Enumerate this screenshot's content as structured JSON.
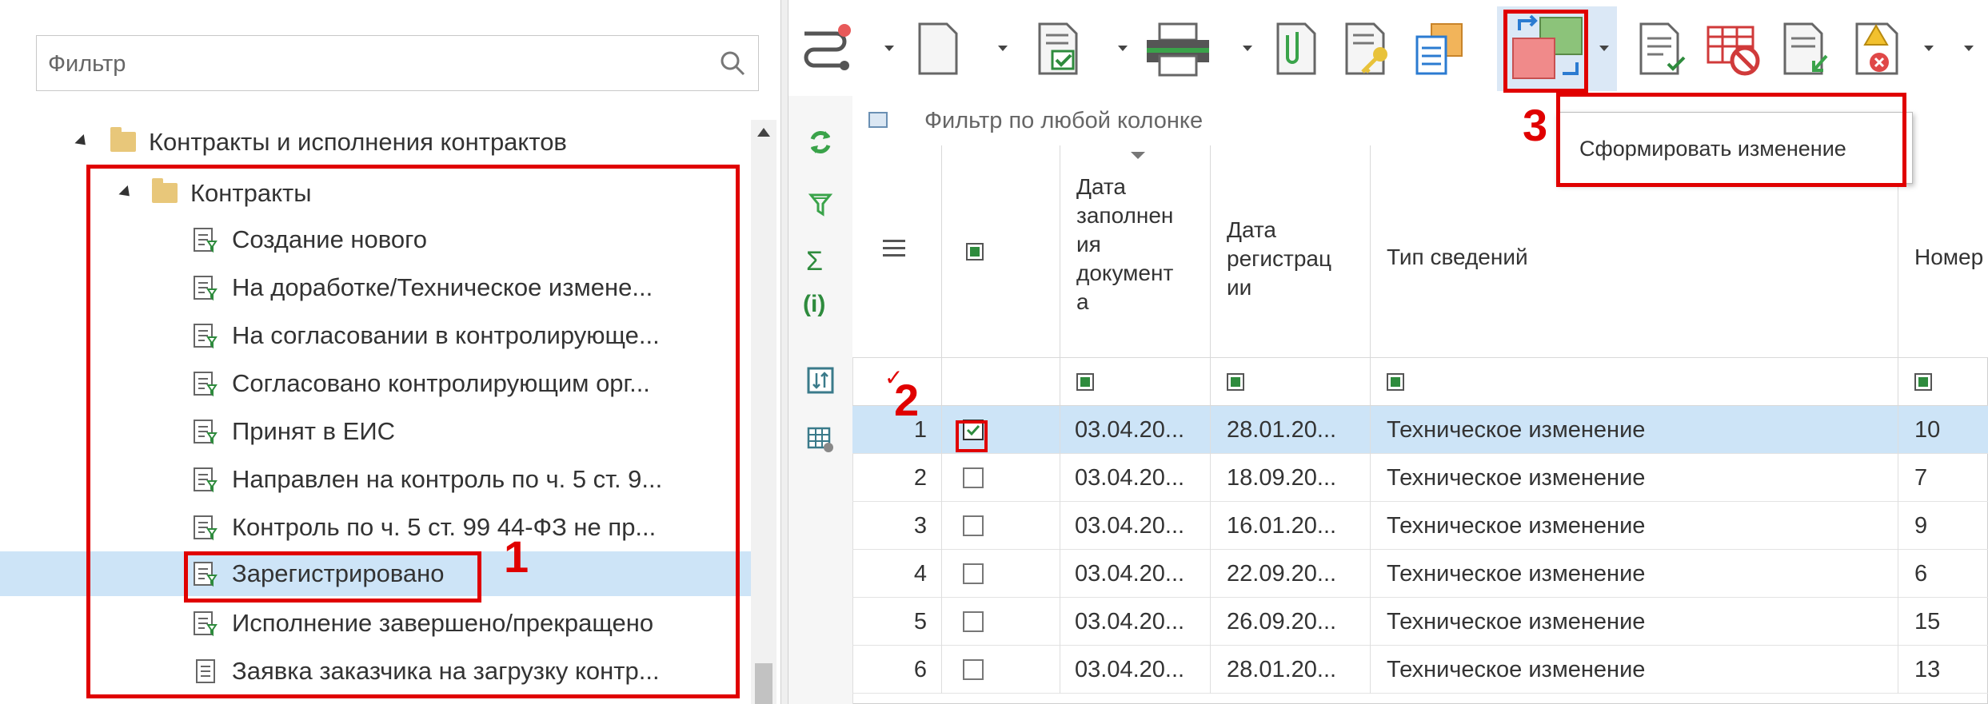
{
  "left_panel": {
    "filter_placeholder": "Фильтр",
    "tree": {
      "root": "Контракты и исполнения контрактов",
      "folder": "Контракты",
      "items": [
        "Создание нового",
        "На доработке/Техническое измене...",
        "На согласовании в контролирующе...",
        "Согласовано контролирующим орг...",
        "Принят в ЕИС",
        "Направлен на контроль по ч. 5 ст. 9...",
        "Контроль по ч. 5 ст. 99 44-ФЗ не пр...",
        "Зарегистрировано",
        "Исполнение завершено/прекращено",
        "Заявка заказчика на загрузку контр..."
      ],
      "selected_item": "Зарегистрировано"
    }
  },
  "toolbar": {
    "tooltip": "Сформировать изменение",
    "icons": [
      "route-icon",
      "new-doc-icon",
      "approve-doc-icon",
      "print-icon",
      "attach-icon",
      "sign-key-icon",
      "clipboard-icon",
      "form-change-icon",
      "doc-check-icon",
      "table-cancel-icon",
      "doc-export-icon",
      "warning-icon"
    ]
  },
  "grid": {
    "filter_placeholder": "Фильтр по любой колонке",
    "columns": [
      "Дата заполнения документа",
      "Дата регистрации",
      "Тип сведений",
      "Номер"
    ],
    "header_lines": {
      "fill_date": [
        "Дата",
        "заполнен",
        "ия",
        "документ",
        "а"
      ],
      "reg_date": [
        "Дата",
        "регистрац",
        "ии"
      ],
      "type": [
        "Тип сведений"
      ],
      "number": [
        "Номер"
      ]
    },
    "rows": [
      {
        "n": "1",
        "fill": "03.04.20...",
        "reg": "28.01.20...",
        "type": "Техническое изменение",
        "num": "10",
        "checked": true
      },
      {
        "n": "2",
        "fill": "03.04.20...",
        "reg": "18.09.20...",
        "type": "Техническое изменение",
        "num": "7",
        "checked": false
      },
      {
        "n": "3",
        "fill": "03.04.20...",
        "reg": "16.01.20...",
        "type": "Техническое изменение",
        "num": "9",
        "checked": false
      },
      {
        "n": "4",
        "fill": "03.04.20...",
        "reg": "22.09.20...",
        "type": "Техническое изменение",
        "num": "6",
        "checked": false
      },
      {
        "n": "5",
        "fill": "03.04.20...",
        "reg": "26.09.20...",
        "type": "Техническое изменение",
        "num": "15",
        "checked": false
      },
      {
        "n": "6",
        "fill": "03.04.20...",
        "reg": "28.01.20...",
        "type": "Техническое изменение",
        "num": "13",
        "checked": false
      }
    ]
  },
  "annotations": {
    "one": "1",
    "two": "2",
    "three": "3"
  },
  "colors": {
    "highlight_red": "#e00000",
    "selection_blue": "#cde4f7",
    "check_green": "#2e8b3d"
  }
}
